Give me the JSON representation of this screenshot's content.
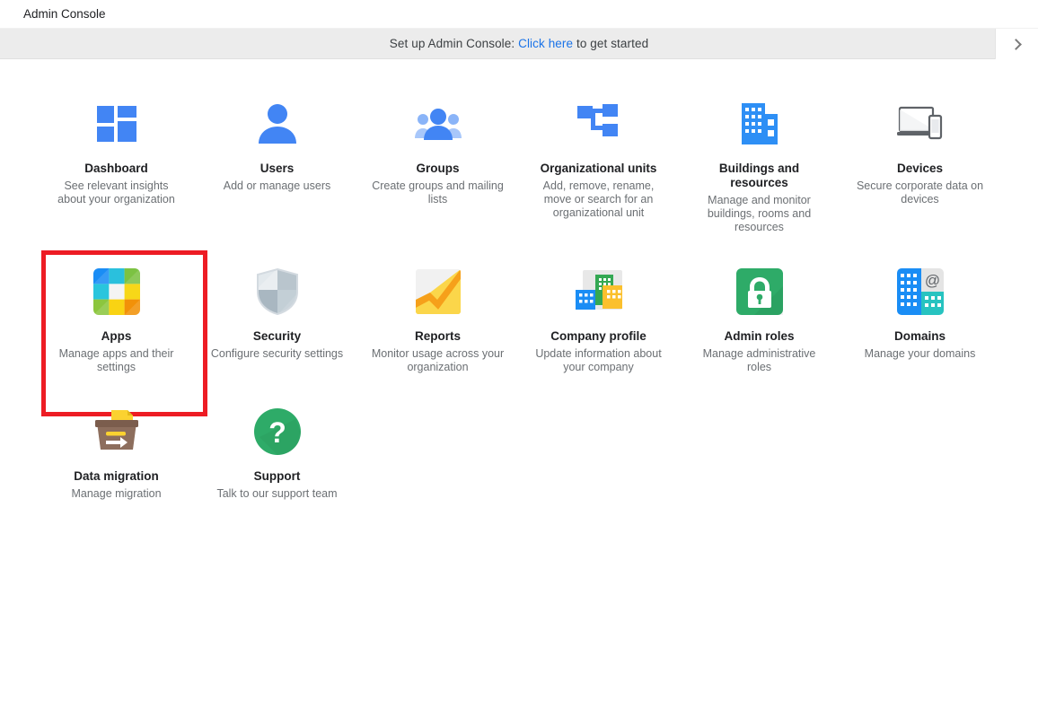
{
  "window": {
    "title": "Admin Console"
  },
  "banner": {
    "prefix": "Set up Admin Console: ",
    "link": "Click here",
    "suffix": " to get started",
    "next_icon": "chevron-right-icon"
  },
  "highlight": {
    "target": "Apps",
    "color": "#ed1c24"
  },
  "tiles": [
    {
      "label": "Dashboard",
      "desc": "See relevant insights about your organization",
      "icon": "dashboard-grid-icon"
    },
    {
      "label": "Users",
      "desc": "Add or manage users",
      "icon": "person-icon"
    },
    {
      "label": "Groups",
      "desc": "Create groups and mailing lists",
      "icon": "people-group-icon"
    },
    {
      "label": "Organizational units",
      "desc": "Add, remove, rename, move or search for an organizational unit",
      "icon": "org-tree-icon"
    },
    {
      "label": "Buildings and resources",
      "desc": "Manage and monitor buildings, rooms and resources",
      "icon": "building-icon"
    },
    {
      "label": "Devices",
      "desc": "Secure corporate data on devices",
      "icon": "laptop-phone-icon"
    },
    {
      "label": "Apps",
      "desc": "Manage apps and their settings",
      "icon": "apps-color-grid-icon"
    },
    {
      "label": "Security",
      "desc": "Configure security settings",
      "icon": "shield-icon"
    },
    {
      "label": "Reports",
      "desc": "Monitor usage across your organization",
      "icon": "analytics-chart-icon"
    },
    {
      "label": "Company profile",
      "desc": "Update information about your company",
      "icon": "company-buildings-icon"
    },
    {
      "label": "Admin roles",
      "desc": "Manage administrative roles",
      "icon": "padlock-icon"
    },
    {
      "label": "Domains",
      "desc": "Manage your domains",
      "icon": "domain-at-icon"
    },
    {
      "label": "Data migration",
      "desc": "Manage migration",
      "icon": "migration-box-icon"
    },
    {
      "label": "Support",
      "desc": "Talk to our support team",
      "icon": "question-circle-icon"
    }
  ],
  "colors": {
    "accent_blue": "#4285f4",
    "banner_bg": "#ececec",
    "link": "#1a73e8",
    "highlight_red": "#ed1c24"
  }
}
